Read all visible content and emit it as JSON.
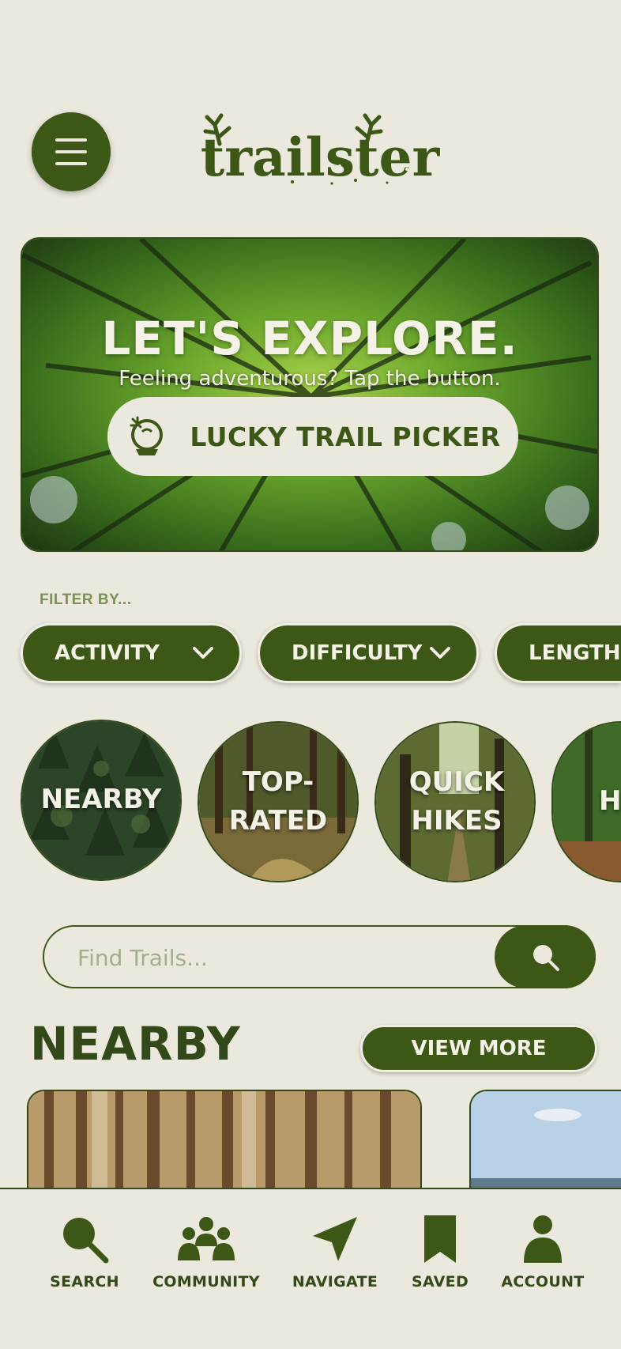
{
  "app": {
    "logo_text": "trailster"
  },
  "colors": {
    "primary": "#3d5717",
    "background": "#ebe9dd",
    "text_light": "#f4f2e6"
  },
  "hero": {
    "title": "LET'S EXPLORE.",
    "subtitle": "Feeling adventurous? Tap the button.",
    "button_label": "LUCKY TRAIL PICKER",
    "button_icon": "fortune-ball-icon"
  },
  "filters": {
    "label": "FILTER BY...",
    "items": [
      {
        "label": "ACTIVITY"
      },
      {
        "label": "DIFFICULTY"
      },
      {
        "label": "LENGTH"
      }
    ]
  },
  "categories": [
    {
      "label": "NEARBY"
    },
    {
      "label": "TOP-RATED"
    },
    {
      "label": "QUICK HIKES"
    },
    {
      "label": "HA"
    }
  ],
  "search": {
    "placeholder": "Find Trails...",
    "icon": "search-icon"
  },
  "section": {
    "title": "NEARBY",
    "view_more_label": "VIEW MORE"
  },
  "nav": {
    "items": [
      {
        "label": "SEARCH",
        "icon": "search-icon"
      },
      {
        "label": "COMMUNITY",
        "icon": "community-icon"
      },
      {
        "label": "NAVIGATE",
        "icon": "navigate-icon"
      },
      {
        "label": "SAVED",
        "icon": "bookmark-icon"
      },
      {
        "label": "ACCOUNT",
        "icon": "account-icon"
      }
    ]
  }
}
